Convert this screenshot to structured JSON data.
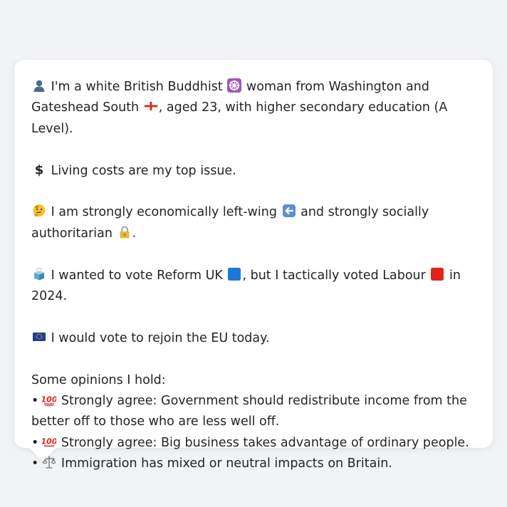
{
  "message": {
    "identity": {
      "icon": "person-silhouette-icon",
      "text_1": "I'm a white British Buddhist",
      "icon_religion": "dharma-wheel-icon",
      "text_2": "woman from Washington and Gateshead South",
      "icon_flag": "england-flag-icon",
      "text_3": ", aged 23, with higher secondary education (A Level)."
    },
    "issue": {
      "icon": "dollar-sign-icon",
      "text": "Living costs are my top issue."
    },
    "ideology": {
      "icon": "thinking-face-icon",
      "text_1": "I am strongly economically left-wing",
      "icon_left": "left-arrow-icon",
      "text_2": "and strongly socially authoritarian",
      "icon_lock": "lock-icon",
      "text_3": "."
    },
    "vote": {
      "icon": "ballot-box-icon",
      "text_1": "I wanted to vote Reform UK",
      "icon_reform": "blue-square-icon",
      "text_2": ", but I tactically voted Labour",
      "icon_labour": "red-square-icon",
      "text_3": "in 2024."
    },
    "eu": {
      "icon": "eu-flag-icon",
      "text": "I would vote to rejoin the EU today."
    },
    "opinions_header": "Some opinions I hold:",
    "opinions": [
      {
        "bullet": "•",
        "icon": "hundred-points-icon",
        "text": "Strongly agree: Government should redistribute income from the better off to those who are less well off."
      },
      {
        "bullet": "•",
        "icon": "hundred-points-icon",
        "text": "Strongly agree: Big business takes advantage of ordinary people."
      },
      {
        "bullet": "•",
        "icon": "balance-scale-icon",
        "text": "Immigration has mixed or neutral impacts on Britain."
      }
    ]
  }
}
